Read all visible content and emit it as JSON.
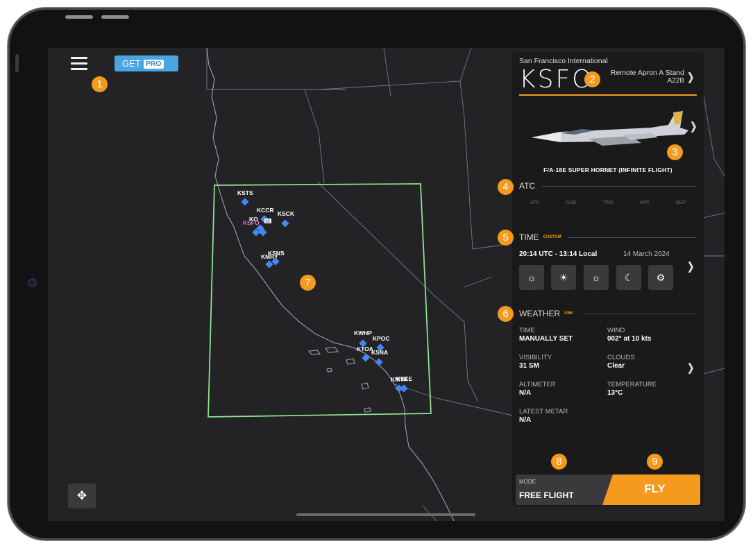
{
  "top_bar": {
    "get_label": "GET",
    "pro_label": "PRO"
  },
  "markers": [
    "1",
    "2",
    "3",
    "4",
    "5",
    "6",
    "7",
    "8",
    "9"
  ],
  "map": {
    "airports": [
      {
        "code": "KSTS",
        "color": "#ffffff"
      },
      {
        "code": "KCCR",
        "color": "#ffffff"
      },
      {
        "code": "KSCK",
        "color": "#ffffff"
      },
      {
        "code": "KO",
        "color": "#ffffff"
      },
      {
        "code": "KSFO",
        "color": "#d77bd4"
      },
      {
        "code": "KMRY",
        "color": "#ffffff"
      },
      {
        "code": "KSNS",
        "color": "#ffffff"
      },
      {
        "code": "KWHP",
        "color": "#ffffff"
      },
      {
        "code": "KPOC",
        "color": "#ffffff"
      },
      {
        "code": "KTOA",
        "color": "#ffffff"
      },
      {
        "code": "KSNA",
        "color": "#ffffff"
      },
      {
        "code": "KMYF",
        "color": "#ffffff"
      },
      {
        "code": "KSEE",
        "color": "#ffffff"
      }
    ],
    "region_color": "#8fe28f",
    "airport_color": "#3f88f5"
  },
  "panel": {
    "airport_name": "San Francisco International",
    "airport_icao": "KSFO",
    "stand_name": "Remote Apron A Stand",
    "stand_code": "A22B",
    "aircraft_name": "F/A-18E SUPER HORNET (INFINITE FLIGHT)",
    "atc": {
      "title": "ATC",
      "tabs": [
        "ATS",
        "GND",
        "TWR",
        "APP",
        "DEP"
      ]
    },
    "time": {
      "title": "TIME",
      "tag": "CUSTOM",
      "utc_local": "20:14 UTC - 13:14 Local",
      "date": "14 March 2024",
      "presets": [
        "sunrise-icon",
        "sun-icon",
        "sunset-icon",
        "moon-icon",
        "gear-icon"
      ]
    },
    "weather": {
      "title": "WEATHER",
      "tag": "UNK",
      "time_label": "TIME",
      "time_value": "MANUALLY SET",
      "wind_label": "WIND",
      "wind_value": "002° at 10 kts",
      "visibility_label": "VISIBILITY",
      "visibility_value": "31 SM",
      "clouds_label": "CLOUDS",
      "clouds_value": "Clear",
      "altimeter_label": "ALTIMETER",
      "altimeter_value": "N/A",
      "temperature_label": "TEMPERATURE",
      "temperature_value": "13°C",
      "metar_label": "LATEST METAR",
      "metar_value": "N/A"
    },
    "mode_label": "MODE",
    "mode_value": "FREE FLIGHT",
    "fly_label": "FLY"
  },
  "accent_color": "#f39a1f"
}
